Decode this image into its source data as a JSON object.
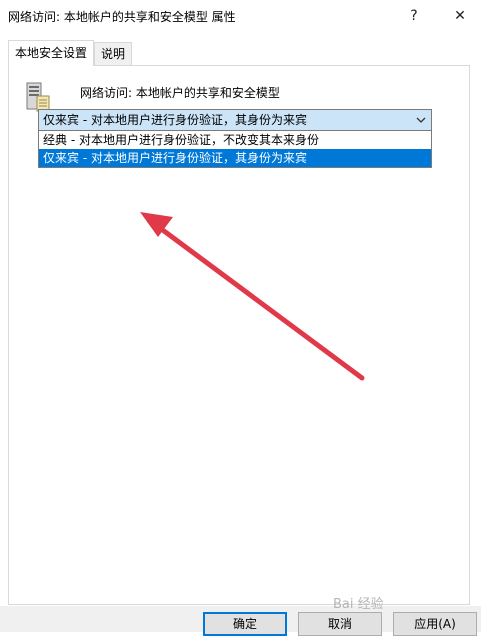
{
  "window": {
    "title": "网络访问: 本地帐户的共享和安全模型 属性",
    "help_glyph": "?",
    "close_glyph": "✕"
  },
  "tabs": [
    {
      "label": "本地安全设置",
      "active": true
    },
    {
      "label": "说明",
      "active": false
    }
  ],
  "policy": {
    "icon": "policy-server-icon",
    "title": "网络访问: 本地帐户的共享和安全模型"
  },
  "select": {
    "value": "仅来宾 - 对本地用户进行身份验证，其身份为来宾",
    "options": [
      {
        "label": "经典 - 对本地用户进行身份验证，不改变其本来身份",
        "selected": false
      },
      {
        "label": "仅来宾 - 对本地用户进行身份验证，其身份为来宾",
        "selected": true
      }
    ]
  },
  "buttons": {
    "ok": "确定",
    "cancel": "取消",
    "apply": "应用(A)"
  },
  "watermark": "Bai 经验",
  "colors": {
    "highlight": "#0078d7",
    "select_bg": "#cce4f7",
    "annotation_arrow": "#e03a4a"
  }
}
